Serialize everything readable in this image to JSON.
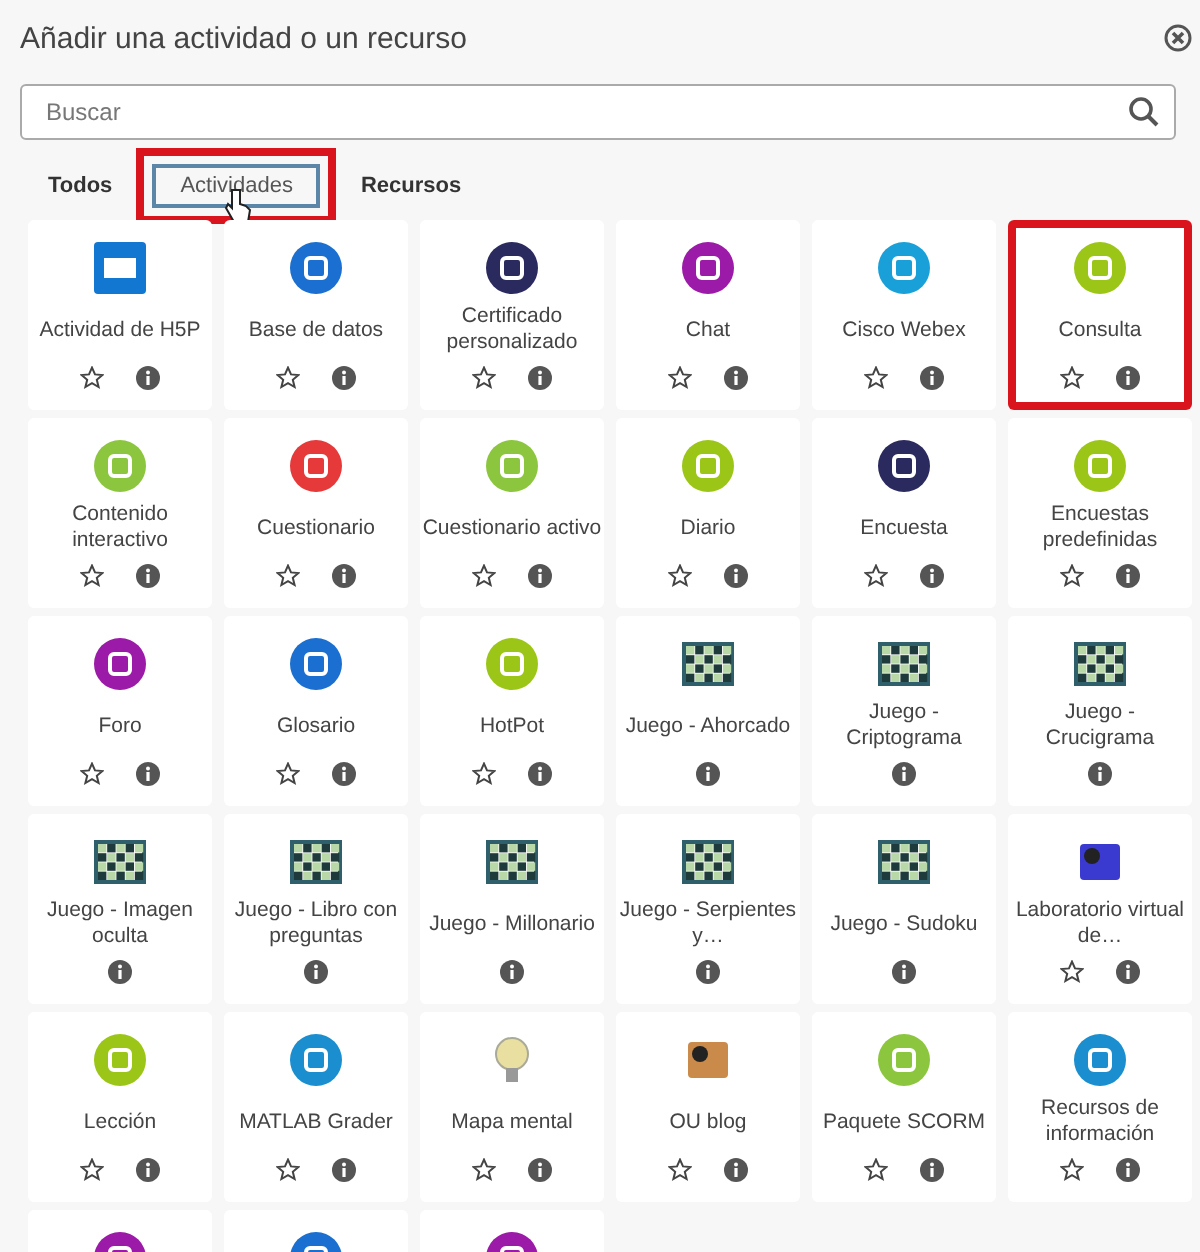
{
  "dialog": {
    "title": "Añadir una actividad o un recurso"
  },
  "search": {
    "placeholder": "Buscar"
  },
  "tabs": [
    {
      "label": "Todos",
      "selected": false,
      "highlighted": false
    },
    {
      "label": "Actividades",
      "selected": true,
      "highlighted": true
    },
    {
      "label": "Recursos",
      "selected": false,
      "highlighted": false
    }
  ],
  "tiles": [
    {
      "label": "Actividad de H5P",
      "kind": "square",
      "color": "#1177d1",
      "starrable": true,
      "highlighted": false
    },
    {
      "label": "Base de datos",
      "kind": "circle",
      "color": "#1a6fd0",
      "starrable": true,
      "highlighted": false
    },
    {
      "label": "Certificado personalizado",
      "kind": "circle",
      "color": "#2b2a5e",
      "starrable": true,
      "highlighted": false
    },
    {
      "label": "Chat",
      "kind": "circle",
      "color": "#9b1aa8",
      "starrable": true,
      "highlighted": false
    },
    {
      "label": "Cisco Webex",
      "kind": "circle",
      "color": "#1aa0d8",
      "starrable": true,
      "highlighted": false
    },
    {
      "label": "Consulta",
      "kind": "circle",
      "color": "#9bc617",
      "starrable": true,
      "highlighted": true
    },
    {
      "label": "Contenido interactivo",
      "kind": "circle",
      "color": "#8cc63f",
      "starrable": true,
      "highlighted": false
    },
    {
      "label": "Cuestionario",
      "kind": "circle",
      "color": "#e5393a",
      "starrable": true,
      "highlighted": false
    },
    {
      "label": "Cuestionario activo",
      "kind": "circle",
      "color": "#8cc63f",
      "starrable": true,
      "highlighted": false
    },
    {
      "label": "Diario",
      "kind": "circle",
      "color": "#9bc617",
      "starrable": true,
      "highlighted": false
    },
    {
      "label": "Encuesta",
      "kind": "circle",
      "color": "#2b2a5e",
      "starrable": true,
      "highlighted": false
    },
    {
      "label": "Encuestas predefinidas",
      "kind": "circle",
      "color": "#9bc617",
      "starrable": true,
      "highlighted": false
    },
    {
      "label": "Foro",
      "kind": "circle",
      "color": "#9b1aa8",
      "starrable": true,
      "highlighted": false
    },
    {
      "label": "Glosario",
      "kind": "circle",
      "color": "#1a6fd0",
      "starrable": true,
      "highlighted": false
    },
    {
      "label": "HotPot",
      "kind": "circle",
      "color": "#9bc617",
      "starrable": true,
      "highlighted": false
    },
    {
      "label": "Juego - Ahorcado",
      "kind": "grid",
      "color": "#2f5f6a",
      "starrable": false,
      "highlighted": false
    },
    {
      "label": "Juego - Criptograma",
      "kind": "grid",
      "color": "#2f5f6a",
      "starrable": false,
      "highlighted": false
    },
    {
      "label": "Juego - Crucigrama",
      "kind": "grid",
      "color": "#2f5f6a",
      "starrable": false,
      "highlighted": false
    },
    {
      "label": "Juego - Imagen oculta",
      "kind": "grid",
      "color": "#2f5f6a",
      "starrable": false,
      "highlighted": false
    },
    {
      "label": "Juego - Libro con preguntas",
      "kind": "grid",
      "color": "#2f5f6a",
      "starrable": false,
      "highlighted": false
    },
    {
      "label": "Juego - Millonario",
      "kind": "grid",
      "color": "#2f5f6a",
      "starrable": false,
      "highlighted": false
    },
    {
      "label": "Juego - Serpientes y…",
      "kind": "grid",
      "color": "#2f5f6a",
      "starrable": false,
      "highlighted": false
    },
    {
      "label": "Juego - Sudoku",
      "kind": "grid",
      "color": "#2f5f6a",
      "starrable": false,
      "highlighted": false
    },
    {
      "label": "Laboratorio virtual de…",
      "kind": "picture",
      "color": "#3a3ad0",
      "starrable": true,
      "highlighted": false
    },
    {
      "label": "Lección",
      "kind": "circle",
      "color": "#9bc617",
      "starrable": true,
      "highlighted": false
    },
    {
      "label": "MATLAB Grader",
      "kind": "circle",
      "color": "#1a8ecf",
      "starrable": true,
      "highlighted": false
    },
    {
      "label": "Mapa mental",
      "kind": "bulb",
      "color": "#e8dfa0",
      "starrable": true,
      "highlighted": false
    },
    {
      "label": "OU blog",
      "kind": "picture",
      "color": "#c98a4a",
      "starrable": true,
      "highlighted": false
    },
    {
      "label": "Paquete SCORM",
      "kind": "circle",
      "color": "#8cc63f",
      "starrable": true,
      "highlighted": false
    },
    {
      "label": "Recursos de información",
      "kind": "circle",
      "color": "#1a8ecf",
      "starrable": true,
      "highlighted": false
    },
    {
      "kind": "circle",
      "color": "#9b1aa8",
      "highlighted": false
    },
    {
      "kind": "circle",
      "color": "#1a6fd0",
      "highlighted": false
    },
    {
      "kind": "circle",
      "color": "#9b1aa8",
      "highlighted": false
    }
  ]
}
